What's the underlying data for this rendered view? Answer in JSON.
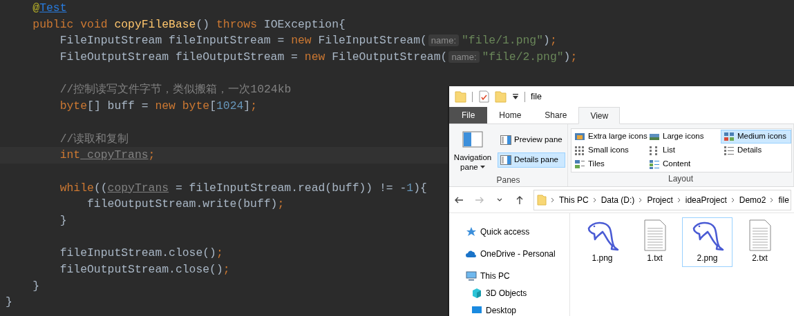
{
  "editor": {
    "lines": [
      {
        "kind": "code",
        "current": false,
        "tokens": [
          {
            "text": "    @",
            "kind": "annotation"
          },
          {
            "text": "Test",
            "kind": "link"
          }
        ]
      },
      {
        "kind": "code",
        "current": false,
        "tokens": [
          {
            "text": "    public",
            "kind": "keyword"
          },
          {
            "text": " void",
            "kind": "keyword"
          },
          {
            "text": " copyFileBase",
            "kind": "method"
          },
          {
            "text": "() ",
            "kind": "plain"
          },
          {
            "text": "throws",
            "kind": "keyword"
          },
          {
            "text": " IOException{",
            "kind": "plain"
          }
        ]
      },
      {
        "kind": "code",
        "current": false,
        "tokens": [
          {
            "text": "        FileInputStream fileInputStream = ",
            "kind": "plain"
          },
          {
            "text": "new",
            "kind": "keyword"
          },
          {
            "text": " FileInputStream(",
            "kind": "plain"
          },
          {
            "text": "name:",
            "kind": "hint"
          },
          {
            "text": "\"file/1.png\"",
            "kind": "string"
          },
          {
            "text": ")",
            "kind": "plain"
          },
          {
            "text": ";",
            "kind": "keyword"
          }
        ]
      },
      {
        "kind": "code",
        "current": false,
        "tokens": [
          {
            "text": "        FileOutputStream fileOutputStream = ",
            "kind": "plain"
          },
          {
            "text": "new",
            "kind": "keyword"
          },
          {
            "text": " FileOutputStream(",
            "kind": "plain"
          },
          {
            "text": "name:",
            "kind": "hint"
          },
          {
            "text": "\"file/2.png\"",
            "kind": "string"
          },
          {
            "text": ")",
            "kind": "plain"
          },
          {
            "text": ";",
            "kind": "keyword"
          }
        ]
      },
      {
        "kind": "blank"
      },
      {
        "kind": "code",
        "current": false,
        "tokens": [
          {
            "text": "        //控制读写文件字节，类似搬箱，一次1024kb",
            "kind": "comment"
          }
        ]
      },
      {
        "kind": "code",
        "current": false,
        "tokens": [
          {
            "text": "        byte",
            "kind": "keyword"
          },
          {
            "text": "[] buff = ",
            "kind": "plain"
          },
          {
            "text": "new",
            "kind": "keyword"
          },
          {
            "text": " byte",
            "kind": "keyword"
          },
          {
            "text": "[",
            "kind": "plain"
          },
          {
            "text": "1024",
            "kind": "number"
          },
          {
            "text": "]",
            "kind": "plain"
          },
          {
            "text": ";",
            "kind": "keyword"
          }
        ]
      },
      {
        "kind": "blank"
      },
      {
        "kind": "code",
        "current": false,
        "tokens": [
          {
            "text": "        //读取和复制",
            "kind": "comment"
          }
        ]
      },
      {
        "kind": "code",
        "current": true,
        "tokens": [
          {
            "text": "        int",
            "kind": "keyword"
          },
          {
            "text": " copyTrans",
            "kind": "unused"
          },
          {
            "text": ";",
            "kind": "keyword"
          }
        ]
      },
      {
        "kind": "blank"
      },
      {
        "kind": "code",
        "current": false,
        "tokens": [
          {
            "text": "        while",
            "kind": "keyword"
          },
          {
            "text": "((",
            "kind": "plain"
          },
          {
            "text": "copyTrans",
            "kind": "unused"
          },
          {
            "text": " = fileInputStream.read(buff)) != -",
            "kind": "plain"
          },
          {
            "text": "1",
            "kind": "number"
          },
          {
            "text": "){",
            "kind": "plain"
          }
        ]
      },
      {
        "kind": "code",
        "current": false,
        "tokens": [
          {
            "text": "            fileOutputStream.write(buff)",
            "kind": "plain"
          },
          {
            "text": ";",
            "kind": "keyword"
          }
        ]
      },
      {
        "kind": "code",
        "current": false,
        "tokens": [
          {
            "text": "        }",
            "kind": "plain"
          }
        ]
      },
      {
        "kind": "blank"
      },
      {
        "kind": "code",
        "current": false,
        "tokens": [
          {
            "text": "        fileInputStream.close()",
            "kind": "plain"
          },
          {
            "text": ";",
            "kind": "keyword"
          }
        ]
      },
      {
        "kind": "code",
        "current": false,
        "tokens": [
          {
            "text": "        fileOutputStream.close()",
            "kind": "plain"
          },
          {
            "text": ";",
            "kind": "keyword"
          }
        ]
      },
      {
        "kind": "code",
        "current": false,
        "tokens": [
          {
            "text": "    }",
            "kind": "plain"
          }
        ]
      },
      {
        "kind": "code",
        "current": false,
        "tokens": [
          {
            "text": "}",
            "kind": "plain"
          }
        ]
      }
    ]
  },
  "explorer": {
    "title": "file",
    "tabs": [
      {
        "label": "File",
        "kind": "file",
        "selected": false
      },
      {
        "label": "Home",
        "kind": "tab",
        "selected": false
      },
      {
        "label": "Share",
        "kind": "tab",
        "selected": false
      },
      {
        "label": "View",
        "kind": "tab",
        "selected": true
      }
    ],
    "panes": {
      "navigation_pane": {
        "label": "Navigation pane"
      },
      "buttons": [
        {
          "label": "Preview pane",
          "selected": false
        },
        {
          "label": "Details pane",
          "selected": true
        }
      ],
      "group_label": "Panes"
    },
    "layout": {
      "options": [
        {
          "label": "Extra large icons",
          "selected": false
        },
        {
          "label": "Large icons",
          "selected": false
        },
        {
          "label": "Medium icons",
          "selected": true
        },
        {
          "label": "Small icons",
          "selected": false
        },
        {
          "label": "List",
          "selected": false
        },
        {
          "label": "Details",
          "selected": false
        },
        {
          "label": "Tiles",
          "selected": false
        },
        {
          "label": "Content",
          "selected": false
        }
      ],
      "group_label": "Layout"
    },
    "nav_buttons": [
      {
        "kind": "back",
        "disabled": false
      },
      {
        "kind": "forward",
        "disabled": true
      },
      {
        "kind": "recent",
        "disabled": false
      },
      {
        "kind": "up",
        "disabled": false
      }
    ],
    "breadcrumbs": [
      "This PC",
      "Data (D:)",
      "Project",
      "ideaProject",
      "Demo2",
      "file"
    ],
    "sidebar": {
      "items": [
        {
          "label": "Quick access",
          "kind": "star"
        },
        {
          "label": "OneDrive - Personal",
          "kind": "cloud"
        },
        {
          "label": "This PC",
          "kind": "pc",
          "children": [
            {
              "label": "3D Objects",
              "kind": "cube"
            },
            {
              "label": "Desktop",
              "kind": "desktop"
            }
          ]
        }
      ]
    },
    "files": [
      {
        "name": "1.png",
        "kind": "image",
        "selected": false
      },
      {
        "name": "1.txt",
        "kind": "text",
        "selected": false
      },
      {
        "name": "2.png",
        "kind": "image",
        "selected": true
      },
      {
        "name": "2.txt",
        "kind": "text",
        "selected": false
      }
    ]
  }
}
